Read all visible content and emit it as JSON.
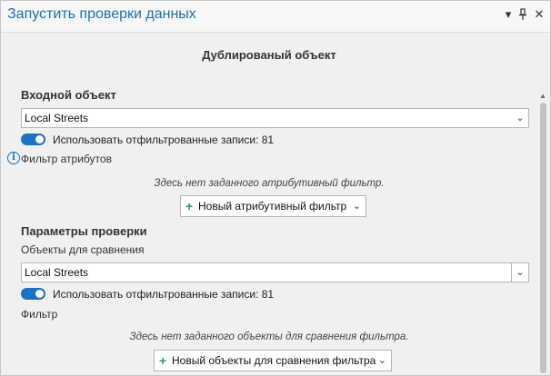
{
  "window": {
    "title": "Запустить проверки данных",
    "menu_icon": "▾",
    "pin_icon": "pin-icon",
    "close_icon": "✕"
  },
  "panel": {
    "title": "Дублированый объект"
  },
  "input_section": {
    "heading": "Входной объект",
    "dropdown_value": "Local Streets",
    "toggle_label": "Использовать отфильтрованные записи: 81",
    "toggle_on": true,
    "attr_filter_label": "Фильтр атрибутов",
    "note": "Здесь нет заданного атрибутивный фильтр.",
    "button_label": "Новый атрибутивный фильтр"
  },
  "params_section": {
    "heading": "Параметры проверки",
    "compare_label": "Объекты для сравнения",
    "dropdown_value": "Local Streets",
    "toggle_label": "Использовать отфильтрованные записи: 81",
    "toggle_on": true,
    "filter_label": "Фильтр",
    "note": "Здесь нет заданного объекты для сравнения фильтра.",
    "button_label": "Новый объекты для сравнения фильтра"
  },
  "colors": {
    "accent": "#1f6fb5",
    "toggle": "#1a73c4",
    "add_icon": "#2e9e3f"
  }
}
